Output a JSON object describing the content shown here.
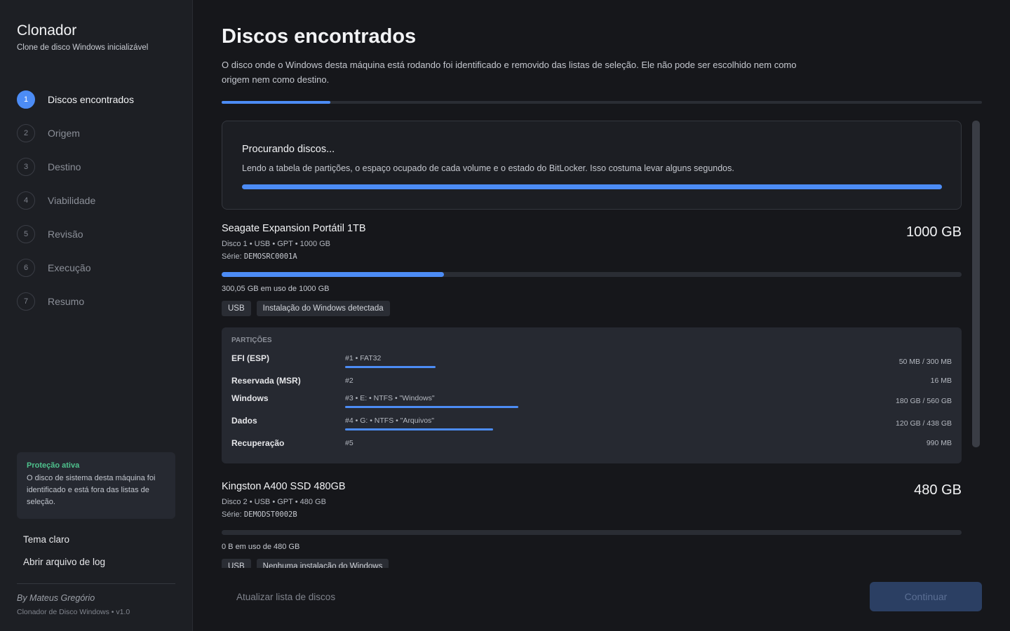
{
  "app": {
    "title": "Clonador",
    "subtitle": "Clone de disco Windows inicializável"
  },
  "steps": [
    {
      "num": "1",
      "label": "Discos encontrados",
      "active": true
    },
    {
      "num": "2",
      "label": "Origem",
      "active": false
    },
    {
      "num": "3",
      "label": "Destino",
      "active": false
    },
    {
      "num": "4",
      "label": "Viabilidade",
      "active": false
    },
    {
      "num": "5",
      "label": "Revisão",
      "active": false
    },
    {
      "num": "6",
      "label": "Execução",
      "active": false
    },
    {
      "num": "7",
      "label": "Resumo",
      "active": false
    }
  ],
  "protection": {
    "title": "Proteção ativa",
    "text": "O disco de sistema desta máquina foi identificado e está fora das listas de seleção."
  },
  "sidebar_links": {
    "theme": "Tema claro",
    "log": "Abrir arquivo de log"
  },
  "footer": {
    "author": "By Mateus Gregório",
    "version": "Clonador de Disco Windows • v1.0"
  },
  "main": {
    "title": "Discos encontrados",
    "description": "O disco onde o Windows desta máquina está rodando foi identificado e removido das listas de seleção. Ele não pode ser escolhido nem como origem nem como destino.",
    "step_progress": 0.143
  },
  "search": {
    "title": "Procurando discos...",
    "text": "Lendo a tabela de partições, o espaço ocupado de cada volume e o estado do BitLocker. Isso costuma levar alguns segundos.",
    "progress": 1.0
  },
  "disks": [
    {
      "name": "Seagate Expansion Portátil 1TB",
      "size": "1000 GB",
      "meta": "Disco 1 • USB • GPT • 1000 GB",
      "serial_label": "Série:",
      "serial": "DEMOSRC0001A",
      "usage_fraction": 0.3,
      "usage_text": "300,05 GB em uso de 1000 GB",
      "tags": [
        "USB",
        "Instalação do Windows detectada"
      ],
      "partitions_header": "PARTIÇÕES",
      "partitions": [
        {
          "name": "EFI (ESP)",
          "info": "#1 • FAT32",
          "size": "50 MB / 300 MB",
          "usage_fraction": 0.167
        },
        {
          "name": "Reservada (MSR)",
          "info": "#2",
          "size": "16 MB",
          "usage_fraction": null
        },
        {
          "name": "Windows",
          "info": "#3 • E: • NTFS • \"Windows\"",
          "size": "180 GB / 560 GB",
          "usage_fraction": 0.321
        },
        {
          "name": "Dados",
          "info": "#4 • G: • NTFS • \"Arquivos\"",
          "size": "120 GB / 438 GB",
          "usage_fraction": 0.274
        },
        {
          "name": "Recuperação",
          "info": "#5",
          "size": "990 MB",
          "usage_fraction": null
        }
      ]
    },
    {
      "name": "Kingston A400 SSD 480GB",
      "size": "480 GB",
      "meta": "Disco 2 • USB • GPT • 480 GB",
      "serial_label": "Série:",
      "serial": "DEMODST0002B",
      "usage_fraction": 0.0,
      "usage_text": "0 B em uso de 480 GB",
      "tags": [
        "USB",
        "Nenhuma instalação do Windows"
      ]
    }
  ],
  "actions": {
    "refresh": "Atualizar lista de discos",
    "continue": "Continuar"
  },
  "colors": {
    "accent": "#4c8cf5",
    "success": "#4ec28d",
    "background": "#16171b",
    "sidebar": "#1d1f24"
  }
}
